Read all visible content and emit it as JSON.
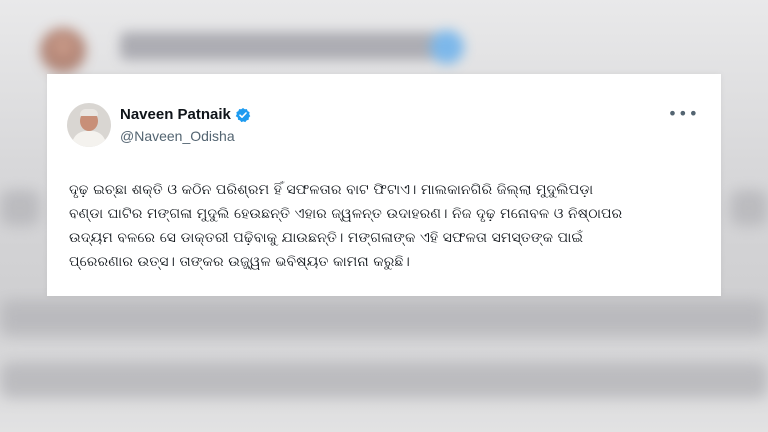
{
  "tweet": {
    "author_name": "Naveen Patnaik",
    "handle": "@Naveen_Odisha",
    "verified_icon": "verified-badge-icon",
    "verified_color": "#1d9bf0",
    "more_icon": "more-options-icon",
    "more_label": "•••",
    "text_lines": [
      "ଦୃଢ଼ ଇଚ୍ଛା ଶକ୍ତି ଓ କଠିନ ପରିଶ୍ରମ ହିଁ ସଫଳତାର ବାଟ ଫିଟାଏ। ମାଲକାନଗିରି ଜିଲ୍ଲା ମୁଦୁଲିପଡ଼ା",
      "ବଣ୍ଡା ଘାଟିର ମଙ୍ଗଳା ମୁଦୁଲି ହେଉଛନ୍ତି ଏହାର ଜ୍ୱଳନ୍ତ ଉଦାହରଣ। ନିଜ ଦୃଢ଼ ମନୋବଳ ଓ ନିଷ୍ଠାପର",
      "ଉଦ୍ୟମ ବଳରେ ସେ ଡାକ୍ତରୀ ପଢ଼ିବାକୁ ଯାଉଛନ୍ତି। ମଙ୍ଗଳାଙ୍କ ଏହି ସଫଳତା ସମସ୍ତଙ୍କ ପାଇଁ",
      "ପ୍ରେରଣାର ଉତ୍ସ। ତାଙ୍କର ଉଜ୍ଜ୍ୱଳ ଭବିଷ୍ୟତ କାମନା କରୁଛି।"
    ]
  }
}
